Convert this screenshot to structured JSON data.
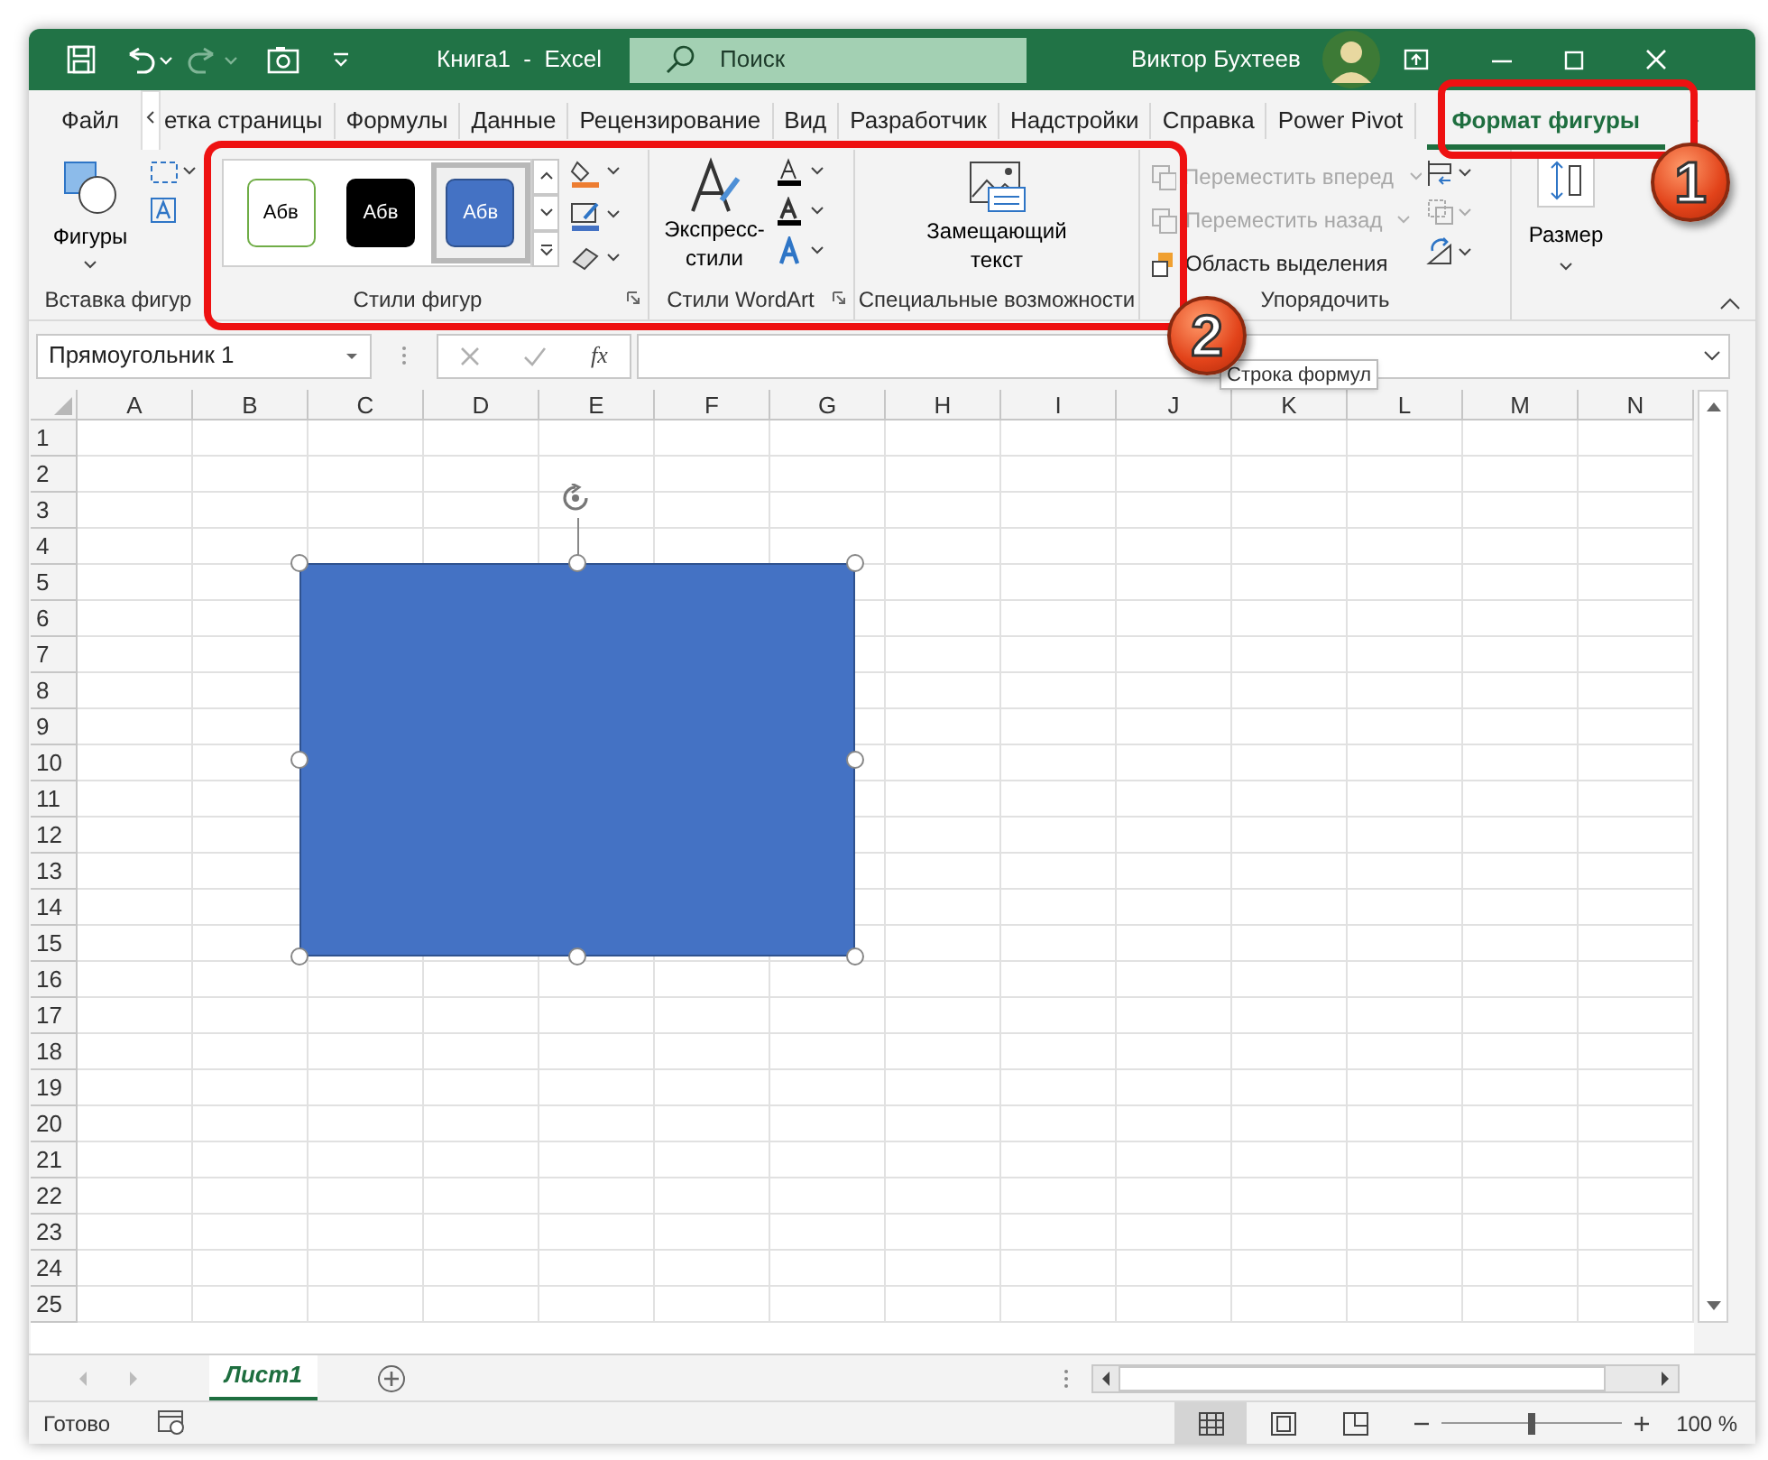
{
  "window": {
    "title": "Книга1  -  Excel",
    "user": "Виктор Бухтеев"
  },
  "search": {
    "placeholder": "Поиск"
  },
  "ribbon_tabs": [
    {
      "label": "Файл",
      "selected": false
    },
    {
      "label": "етка страницы",
      "selected": false
    },
    {
      "label": "Формулы",
      "selected": false
    },
    {
      "label": "Данные",
      "selected": false
    },
    {
      "label": "Рецензирование",
      "selected": false
    },
    {
      "label": "Вид",
      "selected": false
    },
    {
      "label": "Разработчик",
      "selected": false
    },
    {
      "label": "Надстройки",
      "selected": false
    },
    {
      "label": "Справка",
      "selected": false
    },
    {
      "label": "Power Pivot",
      "selected": false
    },
    {
      "label": "Формат фигуры",
      "selected": true
    }
  ],
  "ribbon": {
    "insert_shapes": {
      "label": "Вставка фигур",
      "button": "Фигуры"
    },
    "shape_styles": {
      "label": "Стили фигур",
      "presets": [
        {
          "kind": "outline",
          "text": "Абв",
          "selected": false
        },
        {
          "kind": "black",
          "text": "Абв",
          "selected": false
        },
        {
          "kind": "blue",
          "text": "Абв",
          "selected": true
        }
      ]
    },
    "wordart_styles": {
      "label": "Стили WordArt",
      "button": "Экспресс-стили"
    },
    "accessibility": {
      "label": "Специальные возможности",
      "button": "Замещающий текст"
    },
    "arrange": {
      "label": "Упорядочить",
      "items": [
        {
          "label": "Переместить вперед",
          "disabled": true
        },
        {
          "label": "Переместить назад",
          "disabled": true
        },
        {
          "label": "Область выделения",
          "disabled": false
        }
      ]
    },
    "size": {
      "button": "Размер"
    }
  },
  "name_box": {
    "value": "Прямоугольник 1"
  },
  "formula_bar": {
    "fx": "fx",
    "tooltip": "Строка формул"
  },
  "columns": [
    "A",
    "B",
    "C",
    "D",
    "E",
    "F",
    "G",
    "H",
    "I",
    "J",
    "K",
    "L",
    "M",
    "N"
  ],
  "rows": [
    "1",
    "2",
    "3",
    "4",
    "5",
    "6",
    "7",
    "8",
    "9",
    "10",
    "11",
    "12",
    "13",
    "14",
    "15",
    "16",
    "17",
    "18",
    "19",
    "20",
    "21",
    "22",
    "23",
    "24",
    "25"
  ],
  "sheet_tabs": [
    {
      "label": "Лист1",
      "selected": true
    }
  ],
  "status_bar": {
    "text": "Готово",
    "views": [
      {
        "kind": "normal",
        "selected": true
      },
      {
        "kind": "page_layout",
        "selected": false
      },
      {
        "kind": "page_break",
        "selected": false
      }
    ],
    "zoom": {
      "level": 0.5,
      "reading": "100 %"
    }
  },
  "annotations": [
    {
      "label": "1"
    },
    {
      "label": "2"
    }
  ]
}
